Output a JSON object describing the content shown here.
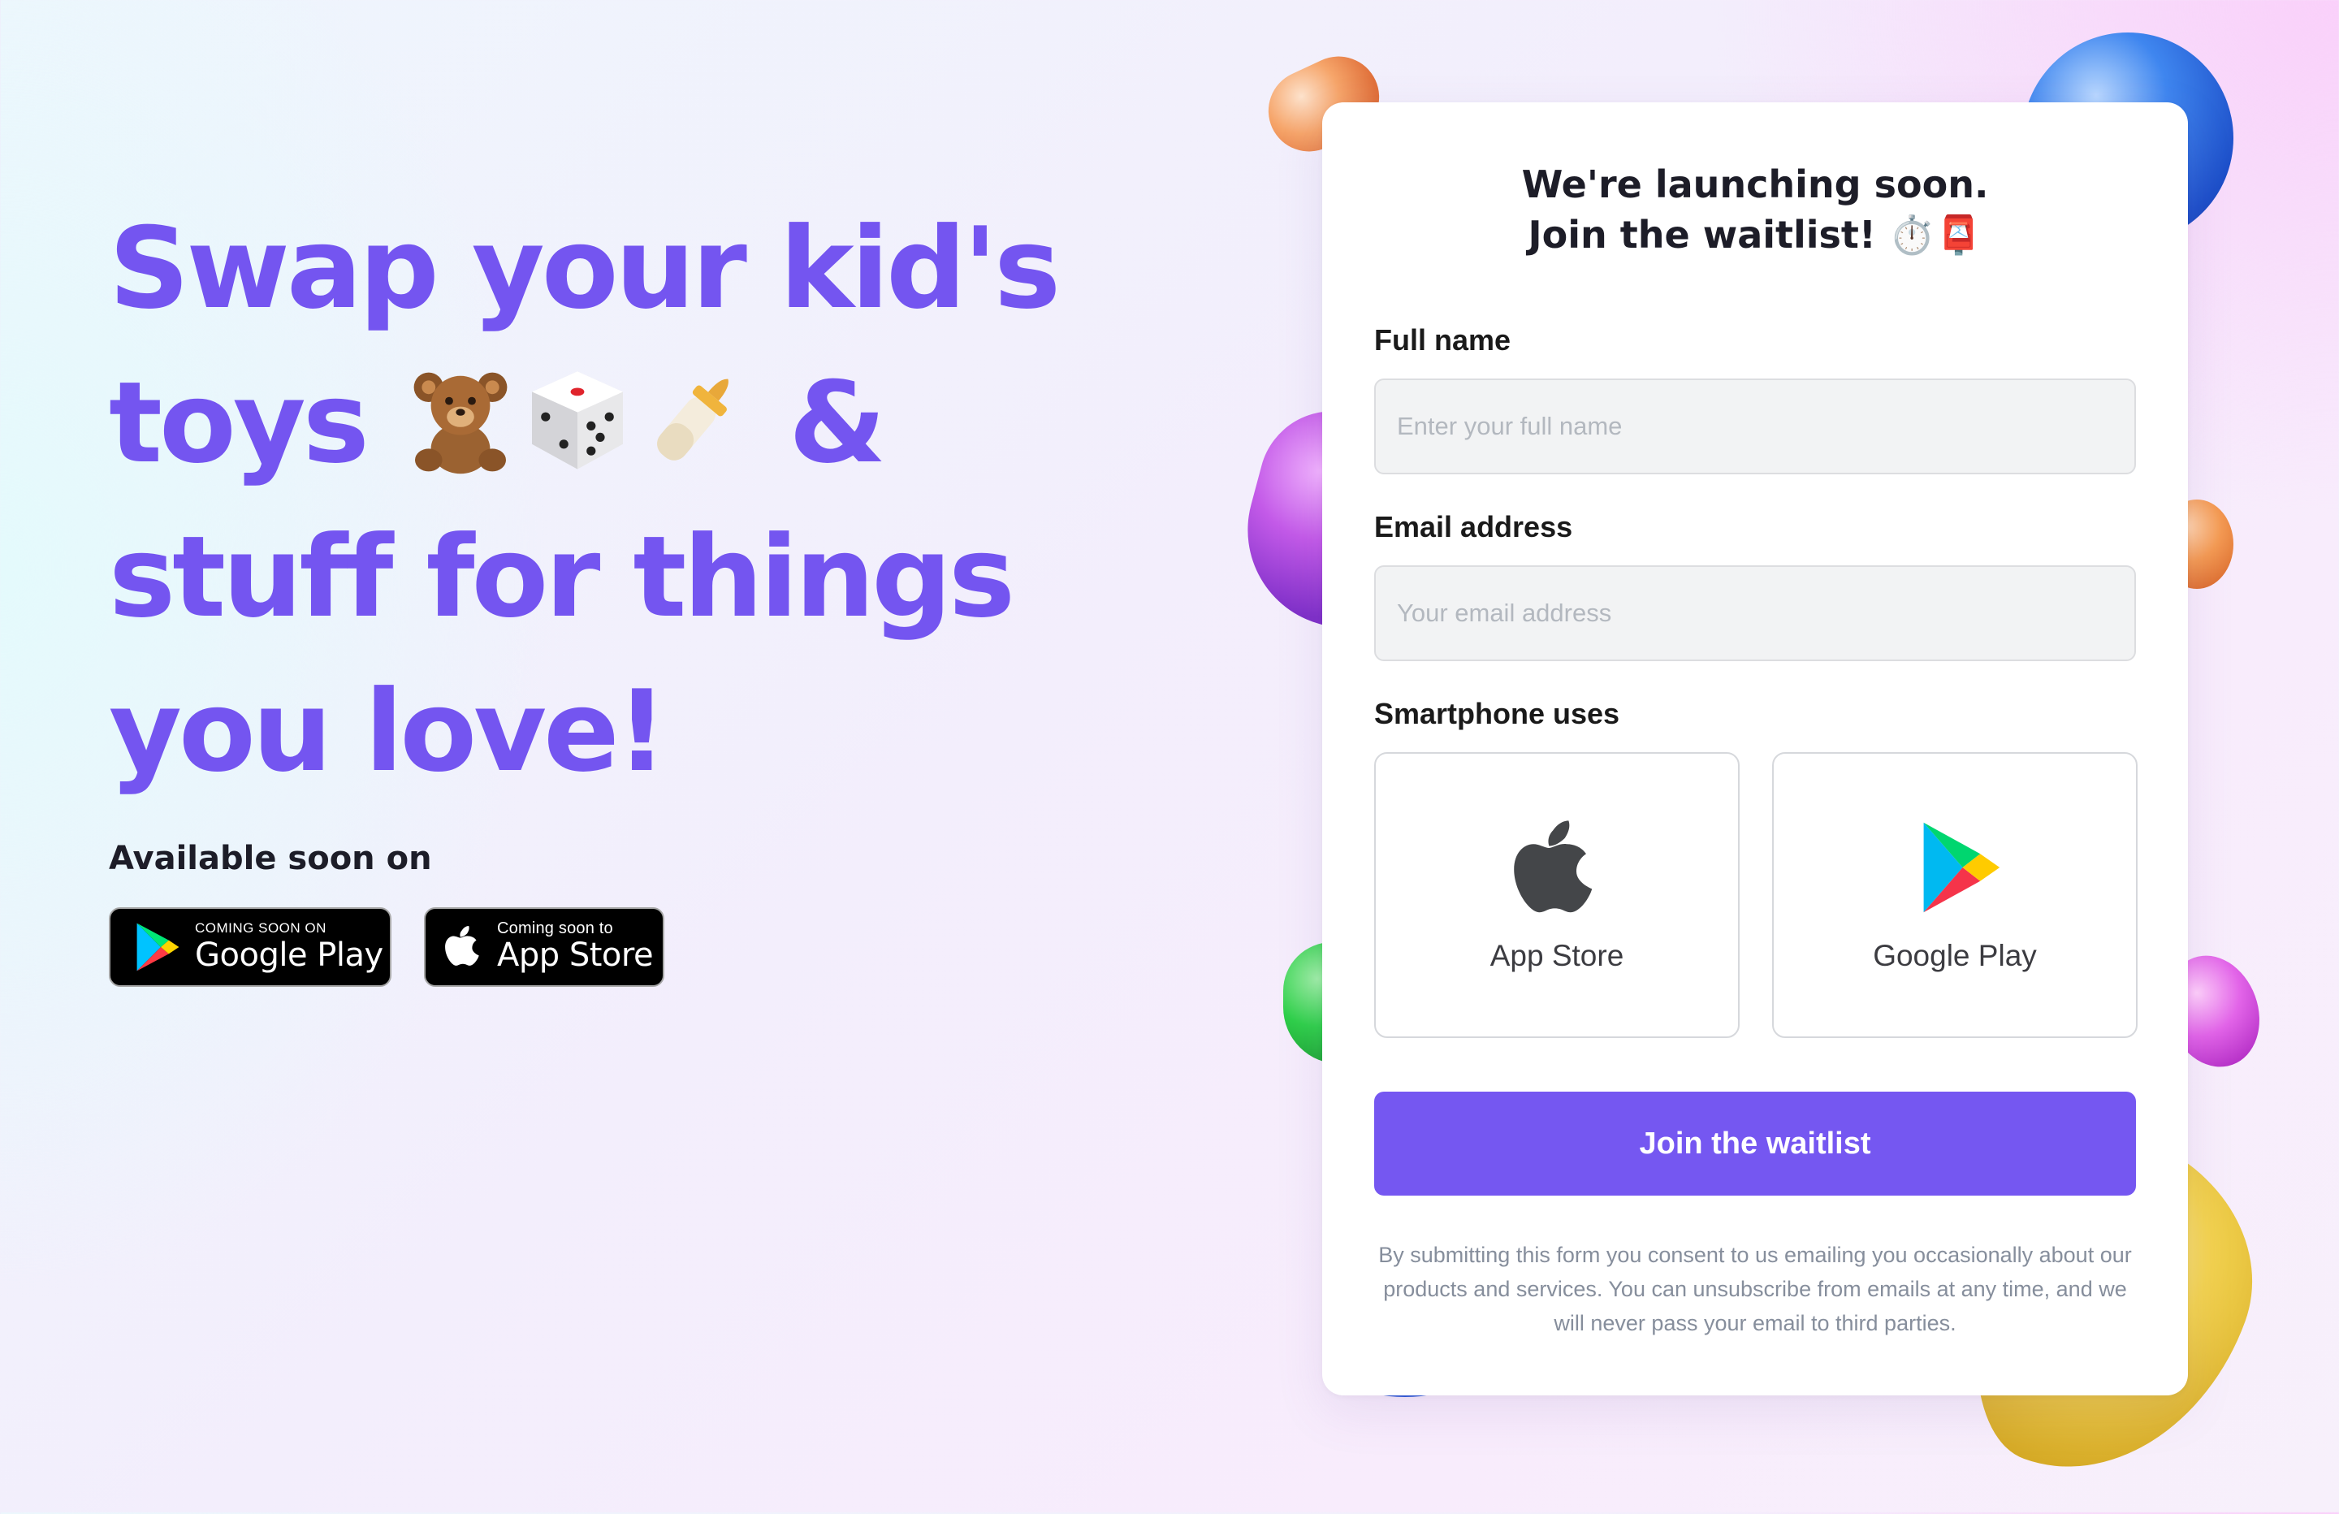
{
  "hero": {
    "title_line1": "Swap your kid's",
    "title_line2_prefix": "toys",
    "title_line2_suffix": " &",
    "title_line3": "stuff for things",
    "title_line4": "you love!",
    "toy_icons": [
      "teddy-bear-icon",
      "dice-icon",
      "baby-bottle-icon"
    ],
    "available_label": "Available soon on"
  },
  "badges": {
    "google": {
      "small": "COMING SOON ON",
      "big": "Google Play"
    },
    "apple": {
      "small": "Coming soon to",
      "big": "App Store"
    }
  },
  "card": {
    "heading_line1": "We're launching soon.",
    "heading_line2": "Join the waitlist! ⏱️📮",
    "full_name": {
      "label": "Full name",
      "placeholder": "Enter your full name",
      "value": ""
    },
    "email": {
      "label": "Email address",
      "placeholder": "Your email address",
      "value": ""
    },
    "smartphone": {
      "label": "Smartphone uses",
      "options": [
        {
          "label": "App Store",
          "icon": "apple-icon"
        },
        {
          "label": "Google Play",
          "icon": "google-play-icon"
        }
      ]
    },
    "submit_label": "Join the waitlist",
    "consent": "By submitting this form you consent to us emailing you occasionally about our products and services. You can unsubscribe from emails at any time, and we will never pass your email to third parties."
  },
  "colors": {
    "brand": "#7455f0",
    "button": "#7557f1",
    "heading": "#1d1d28",
    "muted": "#868e9c"
  }
}
